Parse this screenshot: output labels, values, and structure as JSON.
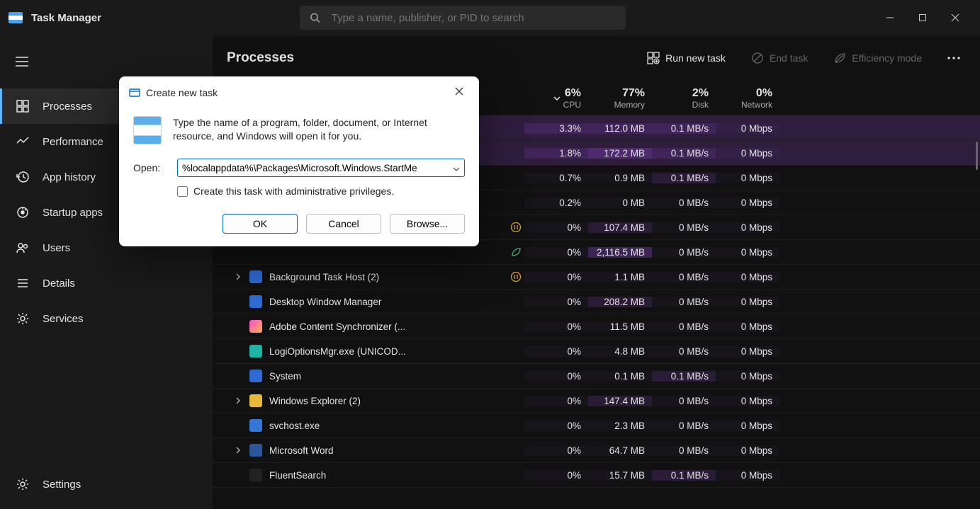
{
  "app": {
    "title": "Task Manager",
    "search_placeholder": "Type a name, publisher, or PID to search"
  },
  "sidebar": {
    "items": [
      {
        "label": "Processes",
        "icon": "processes"
      },
      {
        "label": "Performance",
        "icon": "performance"
      },
      {
        "label": "App history",
        "icon": "history"
      },
      {
        "label": "Startup apps",
        "icon": "startup"
      },
      {
        "label": "Users",
        "icon": "users"
      },
      {
        "label": "Details",
        "icon": "details"
      },
      {
        "label": "Services",
        "icon": "services"
      }
    ],
    "settings_label": "Settings"
  },
  "toolbar": {
    "page_title": "Processes",
    "run_new_task": "Run new task",
    "end_task": "End task",
    "efficiency_mode": "Efficiency mode"
  },
  "columns": {
    "cpu": {
      "pct": "6%",
      "label": "CPU"
    },
    "memory": {
      "pct": "77%",
      "label": "Memory"
    },
    "disk": {
      "pct": "2%",
      "label": "Disk"
    },
    "network": {
      "pct": "0%",
      "label": "Network"
    }
  },
  "rows": [
    {
      "name": "",
      "cpu": "3.3%",
      "mem": "112.0 MB",
      "disk": "0.1 MB/s",
      "net": "0 Mbps",
      "expand": false,
      "icon": "blank",
      "badge": "",
      "sel": true,
      "heat": {
        "cpu": 1,
        "mem": 1,
        "disk": 1,
        "net": 0
      }
    },
    {
      "name": "",
      "cpu": "1.8%",
      "mem": "172.2 MB",
      "disk": "0.1 MB/s",
      "net": "0 Mbps",
      "expand": false,
      "icon": "blank",
      "badge": "",
      "sel": true,
      "heat": {
        "cpu": 1,
        "mem": 2,
        "disk": 1,
        "net": 0
      }
    },
    {
      "name": "",
      "cpu": "0.7%",
      "mem": "0.9 MB",
      "disk": "0.1 MB/s",
      "net": "0 Mbps",
      "expand": false,
      "icon": "blank",
      "badge": "",
      "heat": {
        "cpu": 0,
        "mem": 0,
        "disk": 1,
        "net": 0
      }
    },
    {
      "name": "",
      "cpu": "0.2%",
      "mem": "0 MB",
      "disk": "0 MB/s",
      "net": "0 Mbps",
      "expand": false,
      "icon": "blank",
      "badge": "",
      "heat": {
        "cpu": 0,
        "mem": 0,
        "disk": 0,
        "net": 0
      }
    },
    {
      "name": "",
      "cpu": "0%",
      "mem": "107.4 MB",
      "disk": "0 MB/s",
      "net": "0 Mbps",
      "expand": false,
      "icon": "blank",
      "badge": "pause",
      "heat": {
        "cpu": 0,
        "mem": 1,
        "disk": 0,
        "net": 0
      }
    },
    {
      "name": "",
      "cpu": "0%",
      "mem": "2,116.5 MB",
      "disk": "0 MB/s",
      "net": "0 Mbps",
      "expand": false,
      "icon": "blank",
      "badge": "leaf",
      "heat": {
        "cpu": 0,
        "mem": 2,
        "disk": 0,
        "net": 0
      }
    },
    {
      "name": "Background Task Host (2)",
      "cpu": "0%",
      "mem": "1.1 MB",
      "disk": "0 MB/s",
      "net": "0 Mbps",
      "expand": true,
      "icon": "win",
      "badge": "pause",
      "heat": {
        "cpu": 0,
        "mem": 0,
        "disk": 0,
        "net": 0
      }
    },
    {
      "name": "Desktop Window Manager",
      "cpu": "0%",
      "mem": "208.2 MB",
      "disk": "0 MB/s",
      "net": "0 Mbps",
      "expand": false,
      "icon": "win",
      "badge": "",
      "heat": {
        "cpu": 0,
        "mem": 1,
        "disk": 0,
        "net": 0
      }
    },
    {
      "name": "Adobe Content Synchronizer (...",
      "cpu": "0%",
      "mem": "11.5 MB",
      "disk": "0 MB/s",
      "net": "0 Mbps",
      "expand": false,
      "icon": "adobe",
      "badge": "",
      "heat": {
        "cpu": 0,
        "mem": 0,
        "disk": 0,
        "net": 0
      }
    },
    {
      "name": "LogiOptionsMgr.exe (UNICOD...",
      "cpu": "0%",
      "mem": "4.8 MB",
      "disk": "0 MB/s",
      "net": "0 Mbps",
      "expand": false,
      "icon": "logi",
      "badge": "",
      "heat": {
        "cpu": 0,
        "mem": 0,
        "disk": 0,
        "net": 0
      }
    },
    {
      "name": "System",
      "cpu": "0%",
      "mem": "0.1 MB",
      "disk": "0.1 MB/s",
      "net": "0 Mbps",
      "expand": false,
      "icon": "win",
      "badge": "",
      "heat": {
        "cpu": 0,
        "mem": 0,
        "disk": 1,
        "net": 0
      }
    },
    {
      "name": "Windows Explorer (2)",
      "cpu": "0%",
      "mem": "147.4 MB",
      "disk": "0 MB/s",
      "net": "0 Mbps",
      "expand": true,
      "icon": "folder",
      "badge": "",
      "heat": {
        "cpu": 0,
        "mem": 1,
        "disk": 0,
        "net": 0
      }
    },
    {
      "name": "svchost.exe",
      "cpu": "0%",
      "mem": "2.3 MB",
      "disk": "0 MB/s",
      "net": "0 Mbps",
      "expand": false,
      "icon": "svc",
      "badge": "",
      "heat": {
        "cpu": 0,
        "mem": 0,
        "disk": 0,
        "net": 0
      }
    },
    {
      "name": "Microsoft Word",
      "cpu": "0%",
      "mem": "64.7 MB",
      "disk": "0 MB/s",
      "net": "0 Mbps",
      "expand": true,
      "icon": "word",
      "badge": "",
      "heat": {
        "cpu": 0,
        "mem": 0,
        "disk": 0,
        "net": 0
      }
    },
    {
      "name": "FluentSearch",
      "cpu": "0%",
      "mem": "15.7 MB",
      "disk": "0.1 MB/s",
      "net": "0 Mbps",
      "expand": false,
      "icon": "fluent",
      "badge": "",
      "heat": {
        "cpu": 0,
        "mem": 0,
        "disk": 1,
        "net": 0
      }
    }
  ],
  "dialog": {
    "title": "Create new task",
    "description": "Type the name of a program, folder, document, or Internet resource, and Windows will open it for you.",
    "open_label": "Open:",
    "open_value": "%localappdata%\\Packages\\Microsoft.Windows.StartMe",
    "admin_label": "Create this task with administrative privileges.",
    "ok": "OK",
    "cancel": "Cancel",
    "browse": "Browse..."
  }
}
